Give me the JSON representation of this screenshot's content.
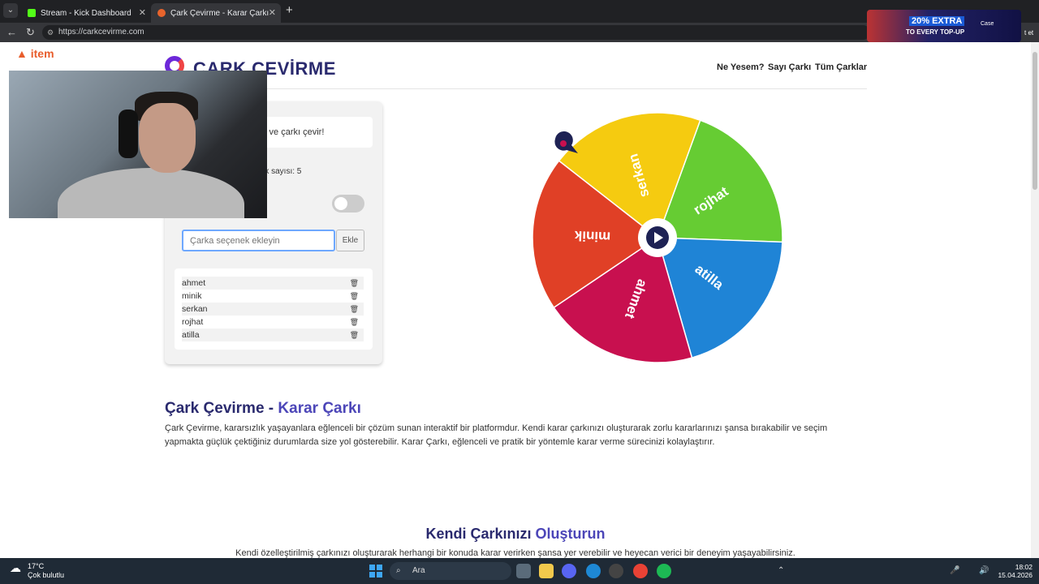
{
  "browser": {
    "tabs": [
      {
        "label": "Stream - Kick Dashboard",
        "favicon_color": "#53fc18"
      },
      {
        "label": "Çark Çevirme - Karar Çarkı",
        "favicon_color": "#e8642c"
      }
    ],
    "url": "https://carkcevirme.com",
    "ad": {
      "headline": "20% EXTRA",
      "sub": "TO EVERY TOP-UP",
      "brand": "Case",
      "tail": "t et"
    }
  },
  "overlay": {
    "logo": "item"
  },
  "header": {
    "brand": "ÇARK ÇEVİRME",
    "nav": [
      "Ne Yesem?",
      "Sayı Çarkı",
      "Tüm Çarklar"
    ]
  },
  "panel": {
    "instruction": "s ve çarkı çevir!",
    "option_count": "rk sayısı: 5",
    "input_placeholder": "Çarka seçenek ekleyin",
    "add_label": "Ekle",
    "items": [
      "ahmet",
      "minik",
      "serkan",
      "rojhat",
      "atilla"
    ]
  },
  "wheel": {
    "segments": [
      {
        "label": "rojhat",
        "color": "#66cc33"
      },
      {
        "label": "atilla",
        "color": "#1f84d6"
      },
      {
        "label": "ahmet",
        "color": "#c8104f"
      },
      {
        "label": "minik",
        "color": "#e04026"
      },
      {
        "label": "serkan",
        "color": "#f5cb10"
      }
    ]
  },
  "section1": {
    "title_a": "Çark Çevirme - ",
    "title_b": "Karar Çarkı",
    "body": "Çark Çevirme, kararsızlık yaşayanlara eğlenceli bir çözüm sunan interaktif bir platformdur. Kendi karar çarkınızı oluşturarak zorlu kararlarınızı şansa bırakabilir ve seçim yapmakta güçlük çektiğiniz durumlarda size yol gösterebilir. Karar Çarkı, eğlenceli ve pratik bir yöntemle karar verme sürecinizi kolaylaştırır."
  },
  "section2": {
    "title_a": "Kendi Çarkınızı ",
    "title_b": "Oluşturun",
    "body": "Kendi özelleştirilmiş çarkınızı oluşturarak herhangi bir konuda karar verirken şansa yer verebilir ve heyecan verici bir deneyim yaşayabilirsiniz."
  },
  "taskbar": {
    "temp": "17°C",
    "weather": "Çok bulutlu",
    "search": "Ara",
    "time": "18:02",
    "date": "15.04.2026"
  }
}
